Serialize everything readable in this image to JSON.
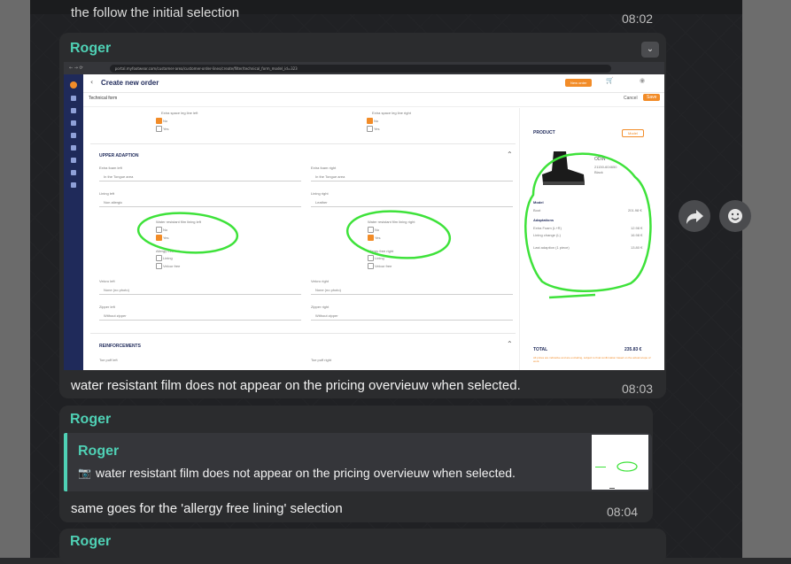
{
  "messages": [
    {
      "text": "the follow the initial selection",
      "time": "08:02"
    },
    {
      "sender": "Roger",
      "text": "water resistant film does not appear on the pricing overvieuw when selected.",
      "time": "08:03"
    },
    {
      "sender": "Roger",
      "quote_sender": "Roger",
      "quote_text": "water resistant film does not appear on the pricing overvieuw when selected.",
      "text": "same goes for the 'allergy free lining' selection",
      "time": "08:04"
    },
    {
      "sender": "Roger"
    }
  ],
  "screenshot": {
    "url": "portal.myfootwear.com/customer-area/customer-order-lines/create/filter/technical_form_model_id=323",
    "page_title": "Create new order",
    "new_order_label": "New order",
    "form_label": "Technical form",
    "cancel_label": "Cancel",
    "save_label": "Save",
    "top_left_checkboxes": [
      {
        "label": "Extra space leg line left"
      },
      {
        "label": "No",
        "checked": true
      },
      {
        "label": "Yes"
      }
    ],
    "top_right_checkboxes": [
      {
        "label": "Extra space leg line right"
      },
      {
        "label": "No",
        "checked": true
      },
      {
        "label": "Yes"
      }
    ],
    "section_upper": "UPPER ADAPTION",
    "extra_foam_left": {
      "label": "Extra foam left",
      "value": "In the Tongue area"
    },
    "extra_foam_right": {
      "label": "Extra foam right",
      "value": "In the Tongue area"
    },
    "lining_left": {
      "label": "Lining left",
      "value": "Non allergic"
    },
    "lining_right": {
      "label": "Lining right",
      "value": "Leather"
    },
    "wrf_left": {
      "label": "Water resistant film lining left",
      "no": "No",
      "yes": "Yes"
    },
    "wrf_right": {
      "label": "Water resistant film lining right",
      "no": "No",
      "yes": "Yes"
    },
    "allergy_left": {
      "label": "Allergy free left",
      "opt1": "Lining",
      "opt2": "Velour free"
    },
    "allergy_right": {
      "label": "Allergy free right",
      "opt1": "Lining",
      "opt2": "Velour free"
    },
    "velcro_left": {
      "label": "Velcro left",
      "value": "None (no photo)"
    },
    "velcro_right": {
      "label": "Velcro right",
      "value": "None (no photo)"
    },
    "zipper_left": {
      "label": "Zipper left",
      "value": "Without zipper"
    },
    "zipper_right": {
      "label": "Zipper right",
      "value": "Without zipper"
    },
    "section_reinforcements": "REINFORCEMENTS",
    "toe_puff_left": "Toe puff left",
    "toe_puff_right": "Toe puff right",
    "product": {
      "heading": "PRODUCT",
      "model_button": "Model",
      "name": "ODIN",
      "code": "21150-604650",
      "color": "Black",
      "model_label": "Model",
      "boot_label": "Boot",
      "boot_price": "201.98 €",
      "adaptations_label": "Adaptations",
      "extra_foam": "Extra Foam (L+R)",
      "extra_foam_price": "12.98 €",
      "lining": "Lining change (L)",
      "lining_price": "16.98 €",
      "last_adaption": "Last adaption (1 piece)",
      "last_adaption_price": "13.80 €",
      "total_label": "TOTAL",
      "total_value": "235.83 €",
      "note": "All prices are indicative and are excluding, subject to final confirmation based on the actual scope of work."
    }
  },
  "annotation_color": "#3ee23a",
  "accent": "#4fd1b5"
}
